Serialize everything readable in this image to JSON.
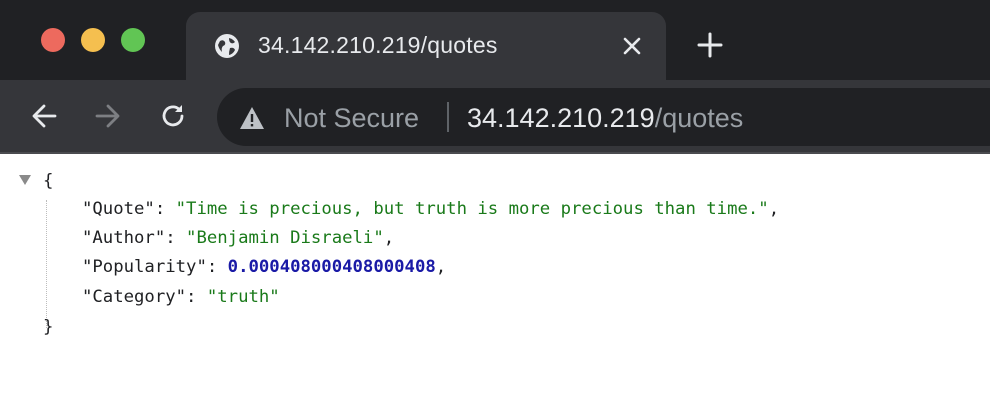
{
  "window": {
    "controls": [
      "close",
      "minimize",
      "zoom"
    ]
  },
  "tab": {
    "title": "34.142.210.219/quotes",
    "favicon": "globe-icon",
    "close_icon": "close-icon"
  },
  "newtab_icon": "plus-icon",
  "toolbar": {
    "back_icon": "arrow-left-icon",
    "forward_icon": "arrow-right-icon",
    "reload_icon": "reload-icon",
    "security_icon": "warning-triangle-icon",
    "security_text": "Not Secure",
    "url_host": "34.142.210.219",
    "url_path": "/quotes"
  },
  "json_view": {
    "open_brace": "{",
    "close_brace": "}",
    "fields": [
      {
        "key": "\"Quote\"",
        "value": "\"Time is precious, but truth is more precious than time.\"",
        "sep": ",",
        "type": "string"
      },
      {
        "key": "\"Author\"",
        "value": "\"Benjamin Disraeli\"",
        "sep": ",",
        "type": "string"
      },
      {
        "key": "\"Popularity\"",
        "value": "0.000408000408000408",
        "sep": ",",
        "type": "number"
      },
      {
        "key": "\"Category\"",
        "value": "\"truth\"",
        "sep": "",
        "type": "string"
      }
    ]
  },
  "colors": {
    "tabstrip": "#202124",
    "tab_active": "#35363a",
    "omnibox": "#202124",
    "string_value": "#1a7a1a",
    "number_value": "#1a1aa6"
  }
}
